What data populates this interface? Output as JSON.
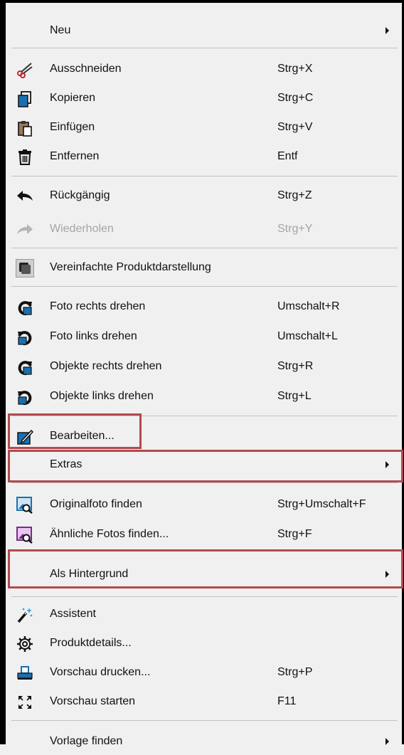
{
  "menu": {
    "new": {
      "label": "Neu"
    },
    "cut": {
      "label": "Ausschneiden",
      "shortcut": "Strg+X",
      "icon": "scissors-icon"
    },
    "copy": {
      "label": "Kopieren",
      "shortcut": "Strg+C",
      "icon": "copy-icon"
    },
    "paste": {
      "label": "Einfügen",
      "shortcut": "Strg+V",
      "icon": "paste-icon"
    },
    "delete": {
      "label": "Entfernen",
      "shortcut": "Entf",
      "icon": "trash-icon"
    },
    "undo": {
      "label": "Rückgängig",
      "shortcut": "Strg+Z",
      "icon": "undo-icon"
    },
    "redo": {
      "label": "Wiederholen",
      "shortcut": "Strg+Y",
      "icon": "redo-icon",
      "disabled": true
    },
    "simplified": {
      "label": "Vereinfachte Produktdarstellung",
      "checked": true
    },
    "photo_rot_right": {
      "label": "Foto rechts drehen",
      "shortcut": "Umschalt+R"
    },
    "photo_rot_left": {
      "label": "Foto links drehen",
      "shortcut": "Umschalt+L"
    },
    "obj_rot_right": {
      "label": "Objekte rechts drehen",
      "shortcut": "Strg+R"
    },
    "obj_rot_left": {
      "label": "Objekte links drehen",
      "shortcut": "Strg+L"
    },
    "edit": {
      "label": "Bearbeiten..."
    },
    "extras": {
      "label": "Extras"
    },
    "find_original": {
      "label": "Originalfoto finden",
      "shortcut": "Strg+Umschalt+F"
    },
    "find_similar": {
      "label": "Ähnliche Fotos finden...",
      "shortcut": "Strg+F"
    },
    "as_background": {
      "label": "Als Hintergrund"
    },
    "assistant": {
      "label": "Assistent"
    },
    "product_details": {
      "label": "Produktdetails..."
    },
    "print_preview": {
      "label": "Vorschau drucken...",
      "shortcut": "Strg+P"
    },
    "start_preview": {
      "label": "Vorschau starten",
      "shortcut": "F11"
    },
    "find_template": {
      "label": "Vorlage finden"
    }
  },
  "colors": {
    "highlight": "#b24a4f",
    "icon_blue": "#1a6fb0",
    "disabled": "#a5a5a5"
  }
}
